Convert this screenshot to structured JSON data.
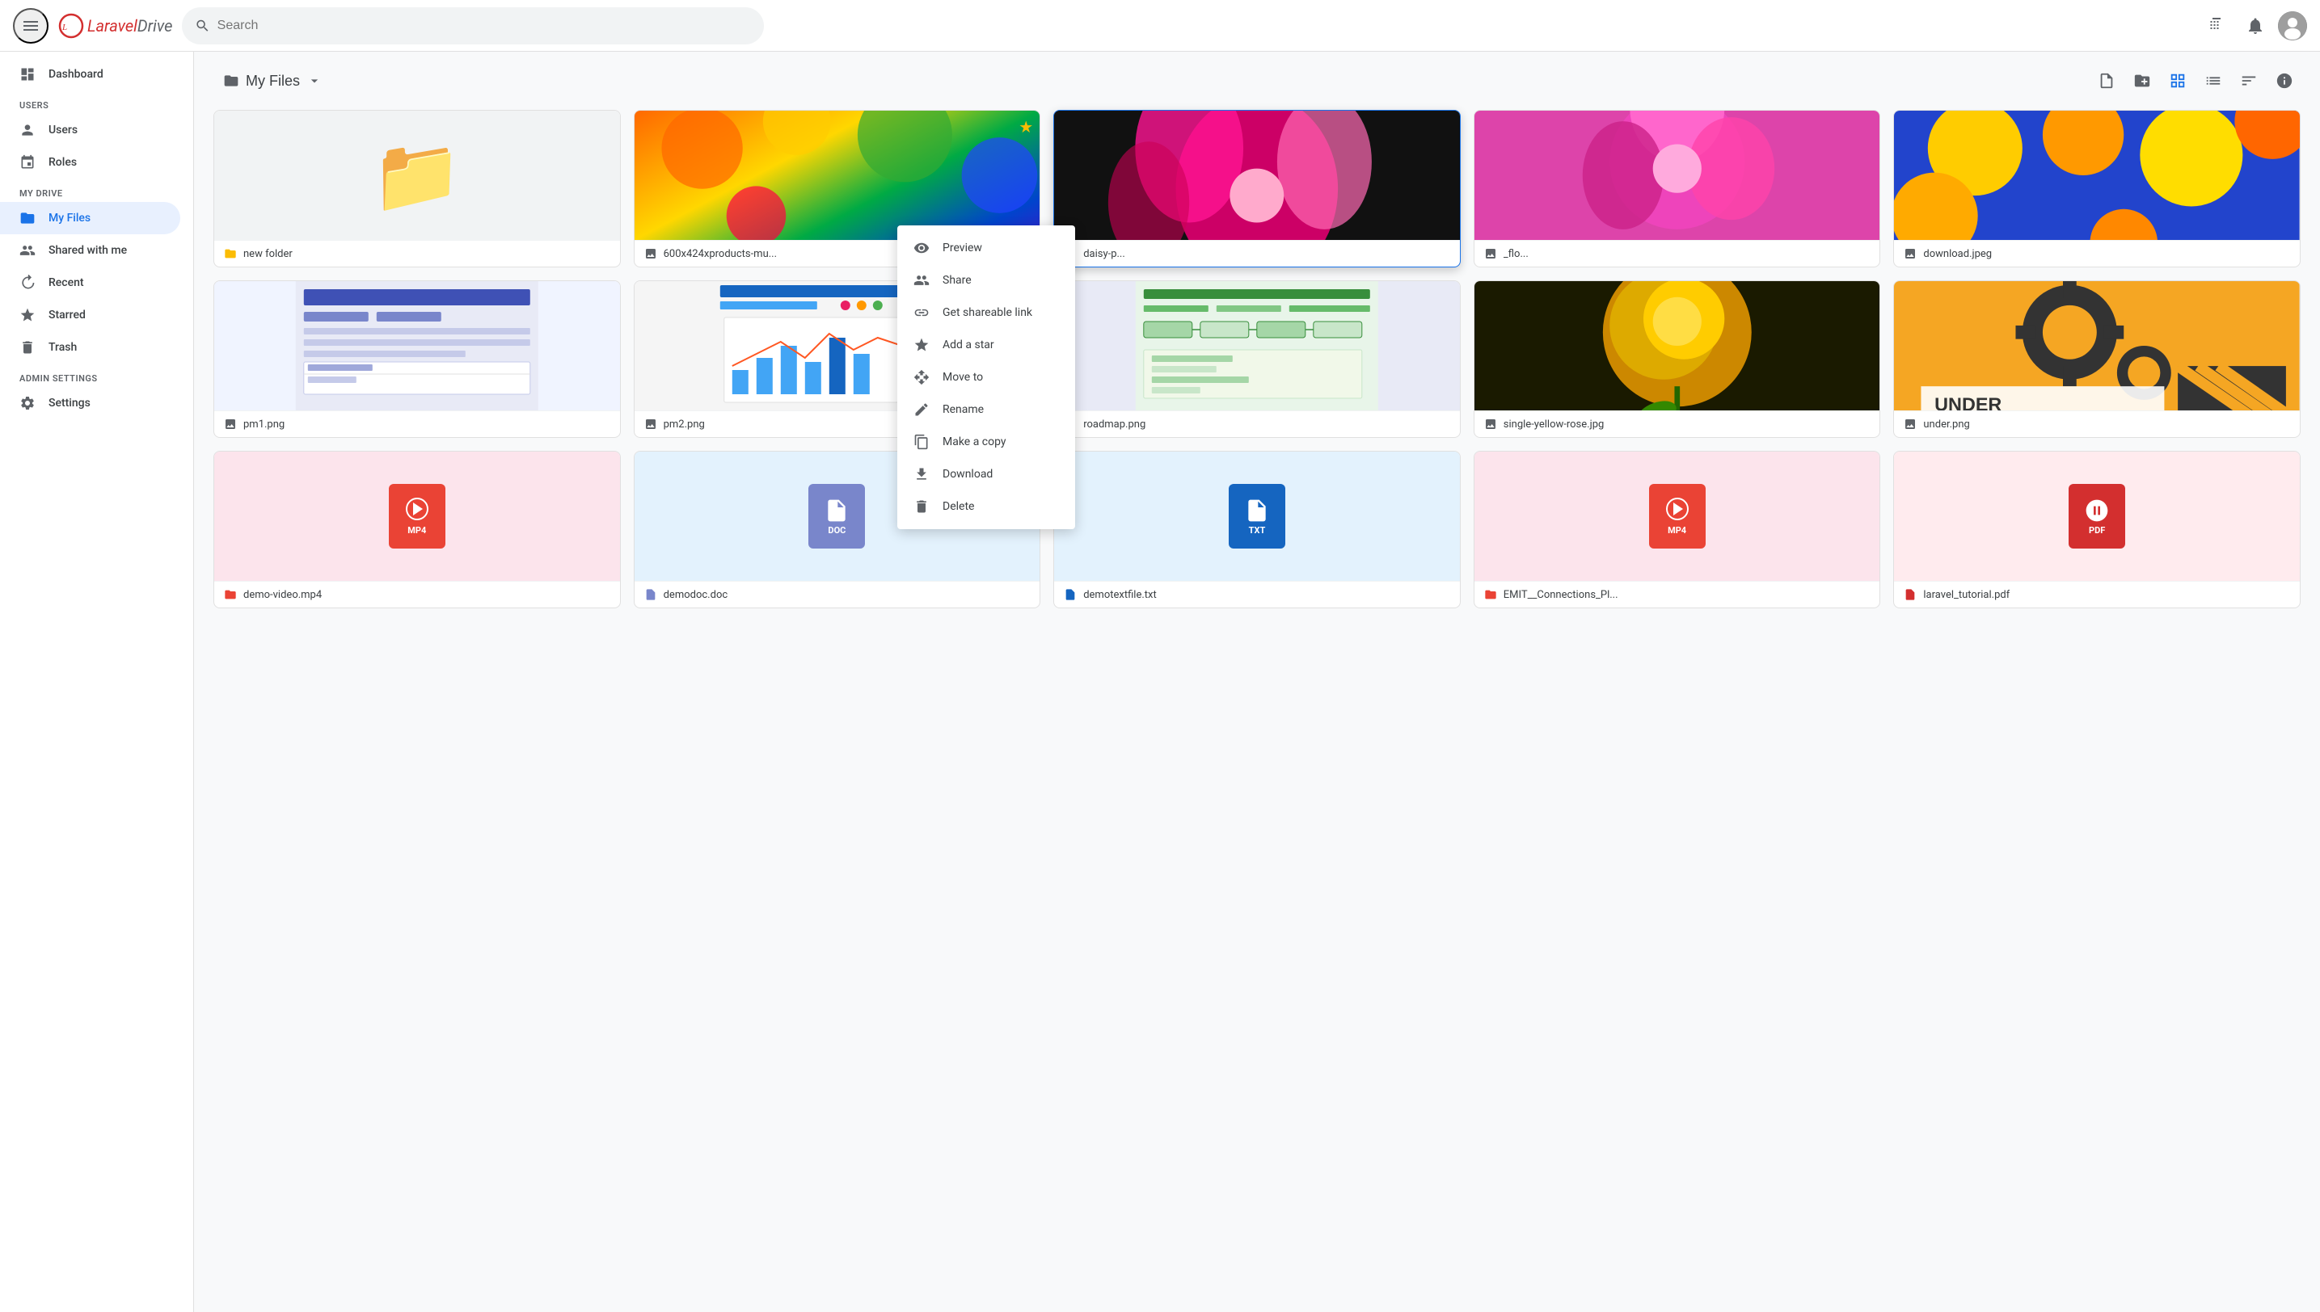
{
  "topbar": {
    "menu_icon": "☰",
    "logo_text": "LaravelDrive",
    "logo_brand": "Laravel",
    "search_placeholder": "Search",
    "apps_icon": "⠿",
    "bell_icon": "🔔"
  },
  "sidebar": {
    "section_users": "Users",
    "section_my_drive": "My Drive",
    "section_admin": "Admin Settings",
    "items": [
      {
        "id": "dashboard",
        "label": "Dashboard",
        "icon": "dashboard"
      },
      {
        "id": "users",
        "label": "Users",
        "icon": "person"
      },
      {
        "id": "roles",
        "label": "Roles",
        "icon": "fingerprint"
      },
      {
        "id": "my-files",
        "label": "My Files",
        "icon": "file"
      },
      {
        "id": "shared",
        "label": "Shared with me",
        "icon": "people"
      },
      {
        "id": "recent",
        "label": "Recent",
        "icon": "clock"
      },
      {
        "id": "starred",
        "label": "Starred",
        "icon": "star"
      },
      {
        "id": "trash",
        "label": "Trash",
        "icon": "trash"
      },
      {
        "id": "settings",
        "label": "Settings",
        "icon": "gear"
      }
    ]
  },
  "files_toolbar": {
    "title": "My Files",
    "dropdown_icon": "▾",
    "upload_file_tooltip": "Upload file",
    "new_folder_tooltip": "New folder",
    "grid_view_tooltip": "Grid view",
    "list_view_tooltip": "List view",
    "sort_tooltip": "Sort",
    "info_tooltip": "Info"
  },
  "files": [
    {
      "id": "new-folder",
      "name": "new folder",
      "type": "folder",
      "thumb_type": "folder",
      "starred": false
    },
    {
      "id": "600x424",
      "name": "600x424xproducts-mu...",
      "type": "image",
      "thumb_type": "rainbow",
      "starred": true
    },
    {
      "id": "daisy",
      "name": "daisy-p...",
      "type": "image",
      "thumb_type": "pink-flower",
      "starred": false,
      "context_active": true
    },
    {
      "id": "flo",
      "name": "_flo...",
      "type": "image",
      "thumb_type": "purple-flower",
      "starred": false
    },
    {
      "id": "download-jpeg",
      "name": "download.jpeg",
      "type": "image",
      "thumb_type": "yellow-flowers",
      "starred": false
    },
    {
      "id": "pm1",
      "name": "pm1.png",
      "type": "image",
      "thumb_type": "screenshot",
      "starred": false
    },
    {
      "id": "pm2",
      "name": "pm2.png",
      "type": "image",
      "thumb_type": "screenshot2",
      "starred": false
    },
    {
      "id": "roadmap",
      "name": "roadmap.png",
      "type": "image",
      "thumb_type": "roadmap",
      "starred": false
    },
    {
      "id": "single-yellow-rose",
      "name": "single-yellow-rose.jpg",
      "type": "image",
      "thumb_type": "yellow-rose",
      "starred": false
    },
    {
      "id": "under",
      "name": "under.png",
      "type": "image",
      "thumb_type": "under-construction",
      "starred": false
    },
    {
      "id": "demo-video",
      "name": "demo-video.mp4",
      "type": "mp4",
      "thumb_type": "mp4",
      "starred": false
    },
    {
      "id": "demodoc",
      "name": "demodoc.doc",
      "type": "doc",
      "thumb_type": "doc",
      "starred": false
    },
    {
      "id": "demotextfile",
      "name": "demotextfile.txt",
      "type": "txt",
      "thumb_type": "txt",
      "starred": false
    },
    {
      "id": "emit-connections",
      "name": "EMIT__Connections_Pl...",
      "type": "mp4",
      "thumb_type": "mp4",
      "starred": false
    },
    {
      "id": "laravel-tutorial",
      "name": "laravel_tutorial.pdf",
      "type": "pdf",
      "thumb_type": "pdf",
      "starred": false
    }
  ],
  "context_menu": {
    "visible": true,
    "target_file": "daisy",
    "items": [
      {
        "id": "preview",
        "label": "Preview",
        "icon": "eye"
      },
      {
        "id": "share",
        "label": "Share",
        "icon": "people"
      },
      {
        "id": "get-link",
        "label": "Get shareable link",
        "icon": "link"
      },
      {
        "id": "add-star",
        "label": "Add a star",
        "icon": "star"
      },
      {
        "id": "move-to",
        "label": "Move to",
        "icon": "move"
      },
      {
        "id": "rename",
        "label": "Rename",
        "icon": "edit"
      },
      {
        "id": "make-copy",
        "label": "Make a copy",
        "icon": "copy"
      },
      {
        "id": "download",
        "label": "Download",
        "icon": "download"
      },
      {
        "id": "delete",
        "label": "Delete",
        "icon": "trash"
      }
    ]
  }
}
